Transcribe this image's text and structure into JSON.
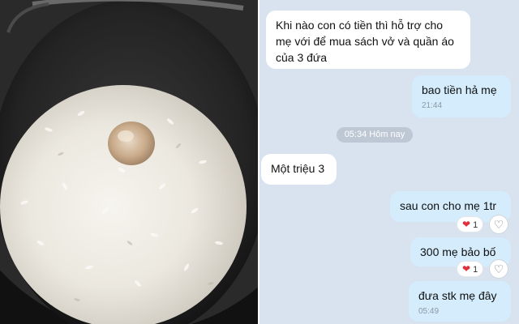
{
  "photo": {
    "subject": "rice-cooker-pot-with-rice-and-egg"
  },
  "messages": [
    {
      "text": "Khi nào con có tiền thì hỗ trợ cho mẹ với  để mua sách vở và quần áo của 3 đứa"
    },
    {
      "text": "bao tiền hả mẹ",
      "time": "21:44"
    },
    {
      "text": "Một triệu 3"
    },
    {
      "text": "sau con cho mẹ 1tr",
      "reaction_icon": "heart-icon",
      "reaction_count": "1"
    },
    {
      "text": "300 mẹ bảo bố",
      "reaction_icon": "heart-icon",
      "reaction_count": "1"
    },
    {
      "text": "đưa stk mẹ đây",
      "time": "05:49"
    }
  ],
  "date_separator": "05:34 Hôm nay",
  "colors": {
    "chat_bg": "#d9e3ef",
    "incoming": "#ffffff",
    "outgoing": "#d4ecfc",
    "heart": "#e0303b"
  }
}
